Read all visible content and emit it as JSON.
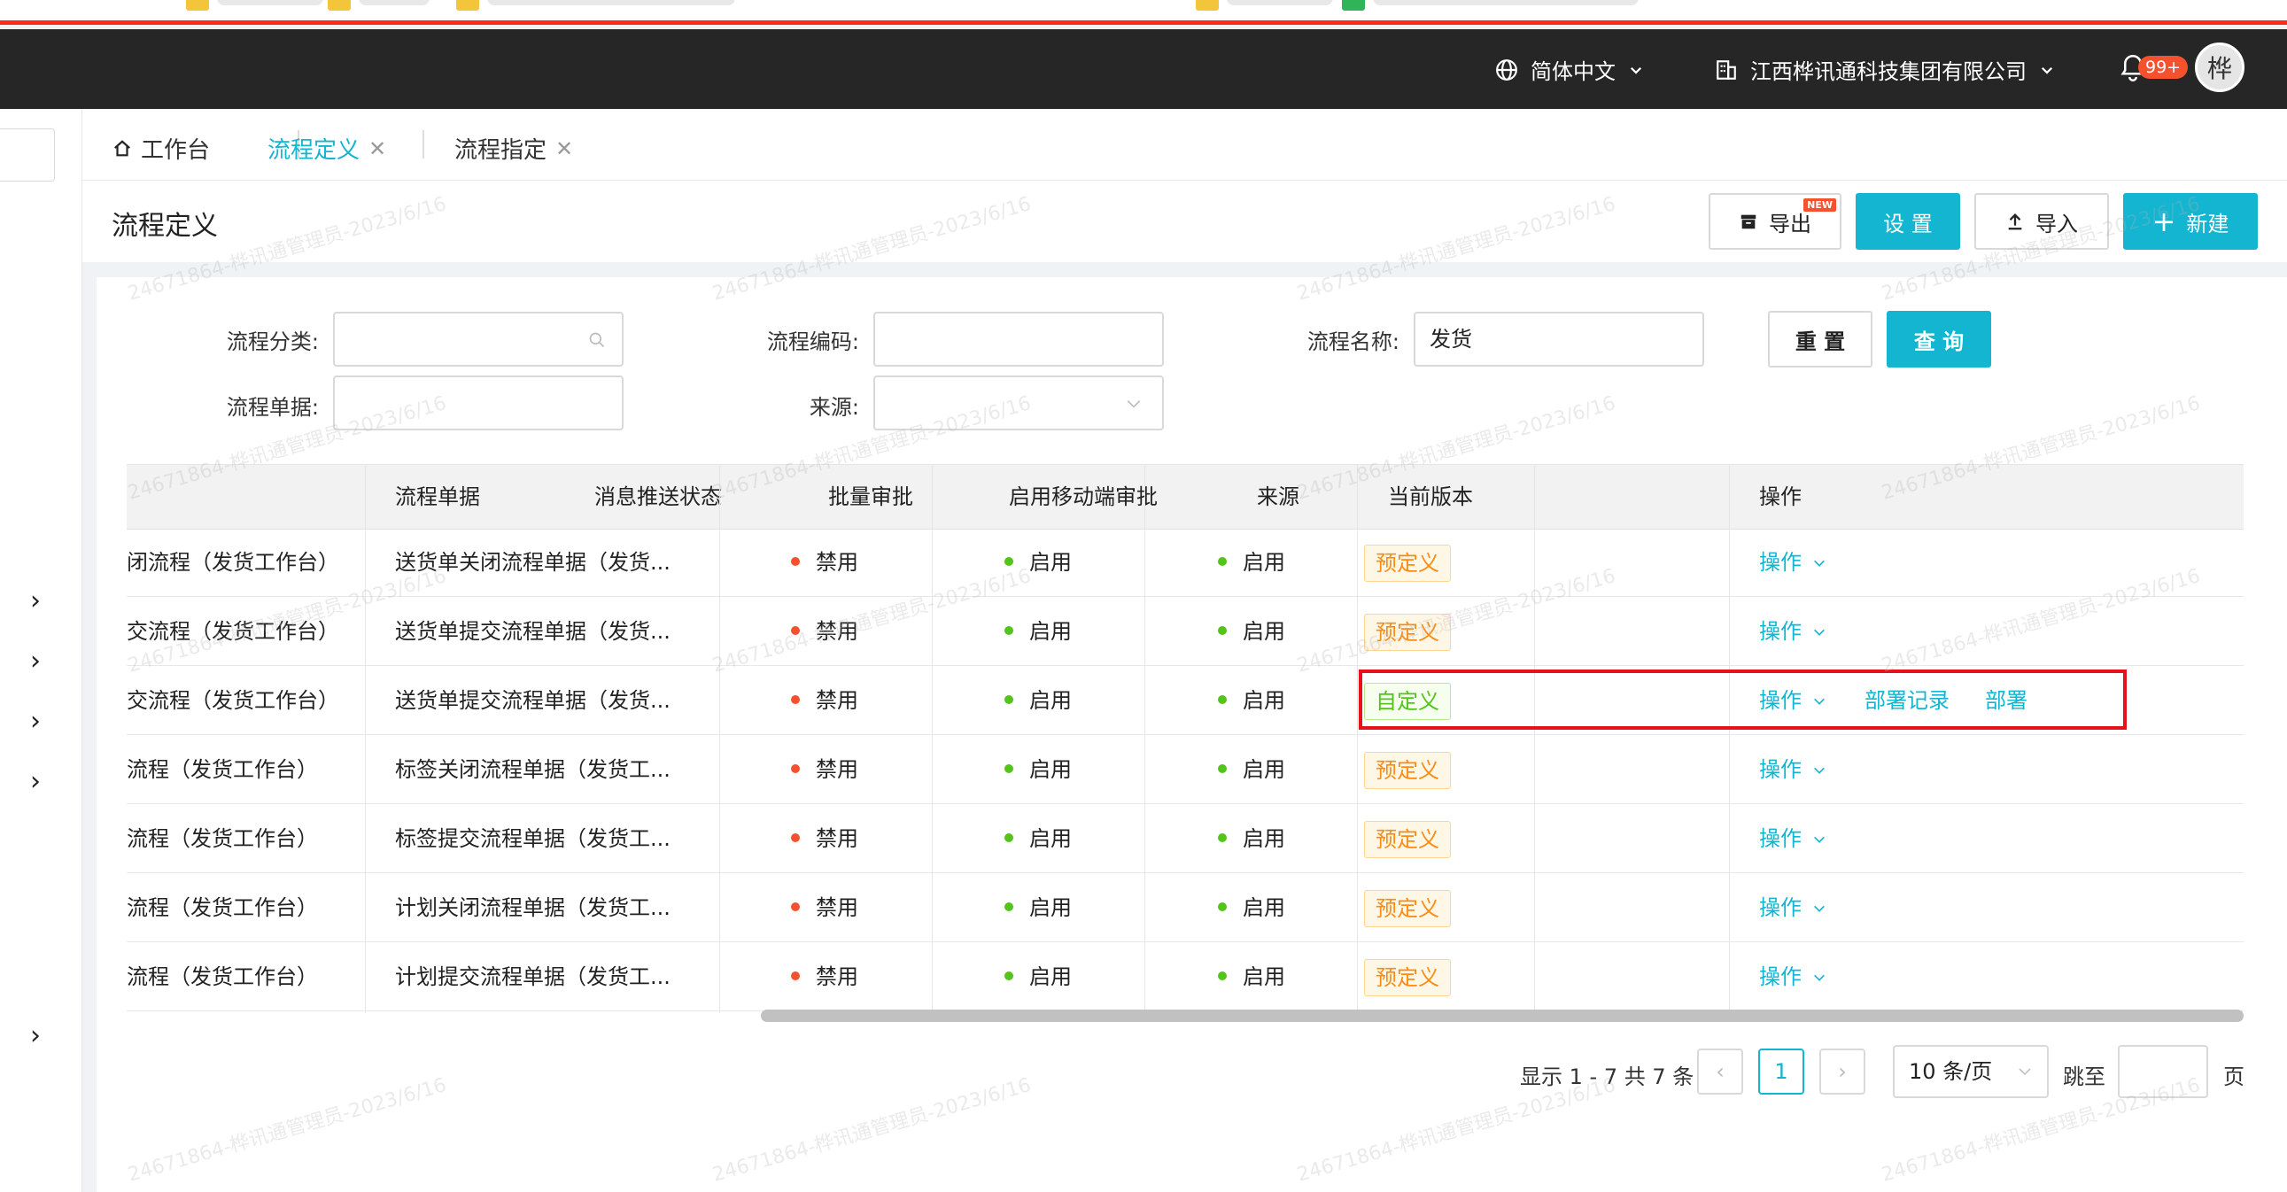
{
  "topbar": {
    "language": "简体中文",
    "company": "江西桦讯通科技集团有限公司",
    "notification_count": "99+",
    "avatar_text": "桦"
  },
  "tabs": [
    {
      "label": "工作台"
    },
    {
      "label": "流程定义"
    },
    {
      "label": "流程指定"
    }
  ],
  "header": {
    "title": "流程定义",
    "export_label": "导出",
    "new_badge": "NEW",
    "settings_label": "设 置",
    "import_label": "导入",
    "create_label": "新建"
  },
  "filters": {
    "category_label": "流程分类:",
    "code_label": "流程编码:",
    "name_label": "流程名称:",
    "name_value": "发货",
    "document_label": "流程单据:",
    "source_label": "来源:",
    "reset_label": "重 置",
    "query_label": "查 询"
  },
  "table": {
    "columns": [
      "流程单据",
      "消息推送状态",
      "批量审批",
      "启用移动端审批",
      "来源",
      "当前版本",
      "操作"
    ],
    "rows": [
      {
        "name": "闭流程（发货工作台）",
        "document": "送货单关闭流程单据（发货...",
        "push": "禁用",
        "batch": "启用",
        "mobile": "启用",
        "source": "预定义",
        "version": "",
        "action": "操作"
      },
      {
        "name": "交流程（发货工作台）",
        "document": "送货单提交流程单据（发货...",
        "push": "禁用",
        "batch": "启用",
        "mobile": "启用",
        "source": "预定义",
        "version": "",
        "action": "操作"
      },
      {
        "name": "交流程（发货工作台）",
        "document": "送货单提交流程单据（发货...",
        "push": "禁用",
        "batch": "启用",
        "mobile": "启用",
        "source": "自定义",
        "version": "",
        "action": "操作",
        "deploy_record": "部署记录",
        "deploy": "部署"
      },
      {
        "name": "流程（发货工作台）",
        "document": "标签关闭流程单据（发货工...",
        "push": "禁用",
        "batch": "启用",
        "mobile": "启用",
        "source": "预定义",
        "version": "",
        "action": "操作"
      },
      {
        "name": "流程（发货工作台）",
        "document": "标签提交流程单据（发货工...",
        "push": "禁用",
        "batch": "启用",
        "mobile": "启用",
        "source": "预定义",
        "version": "",
        "action": "操作"
      },
      {
        "name": "流程（发货工作台）",
        "document": "计划关闭流程单据（发货工...",
        "push": "禁用",
        "batch": "启用",
        "mobile": "启用",
        "source": "预定义",
        "version": "",
        "action": "操作"
      },
      {
        "name": "流程（发货工作台）",
        "document": "计划提交流程单据（发货工...",
        "push": "禁用",
        "batch": "启用",
        "mobile": "启用",
        "source": "预定义",
        "version": "",
        "action": "操作"
      }
    ]
  },
  "pagination": {
    "summary": "显示 1 - 7 共 7 条",
    "current_page": "1",
    "page_size": "10 条/页",
    "jump_label": "跳至",
    "page_unit": "页"
  },
  "watermark": "24671864-桦讯通管理员-2023/6/16",
  "colors": {
    "accent": "#13b5d0",
    "topbar": "#262626",
    "disabled_dot": "#f5512f",
    "enabled_dot": "#52c41a",
    "highlight": "#e8101a"
  }
}
